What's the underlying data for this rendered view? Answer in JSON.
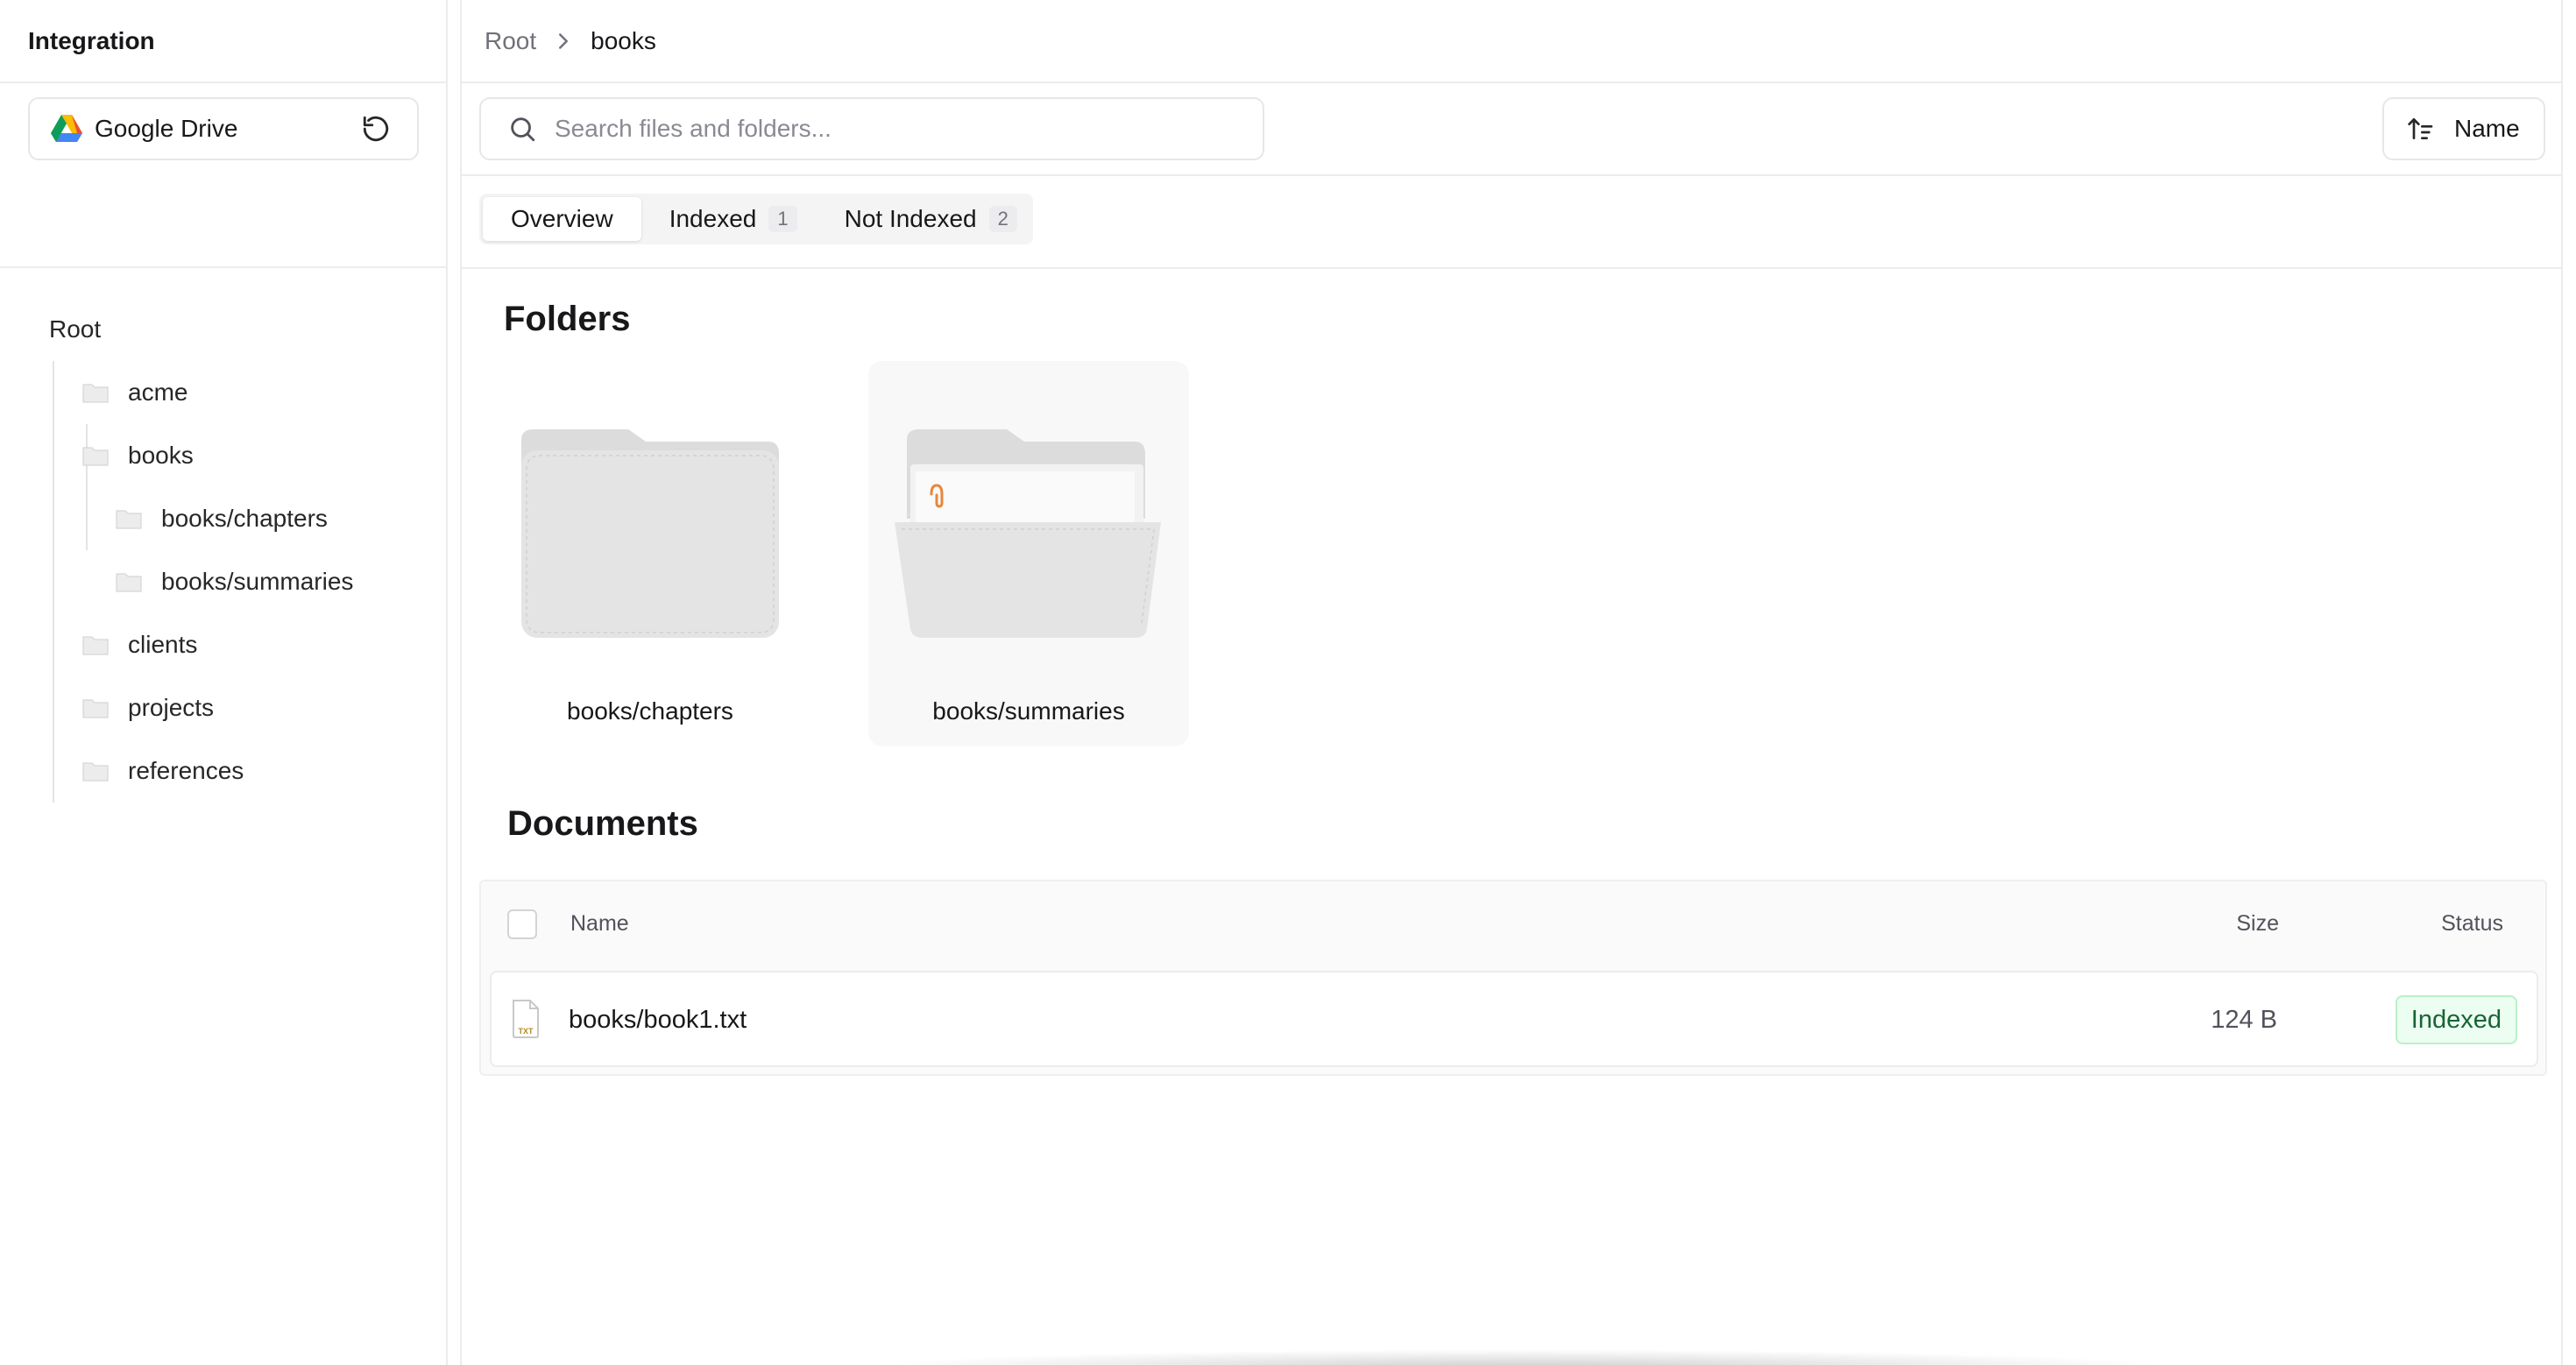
{
  "sidebar": {
    "title": "Integration",
    "source": {
      "name": "Google Drive",
      "icon": "google-drive-icon",
      "refresh_icon": "refresh-icon"
    },
    "tree": {
      "root": "Root",
      "items": [
        {
          "label": "acme",
          "depth": 1
        },
        {
          "label": "books",
          "depth": 1
        },
        {
          "label": "books/chapters",
          "depth": 2
        },
        {
          "label": "books/summaries",
          "depth": 2
        },
        {
          "label": "clients",
          "depth": 1
        },
        {
          "label": "projects",
          "depth": 1
        },
        {
          "label": "references",
          "depth": 1
        }
      ]
    }
  },
  "breadcrumb": {
    "root": "Root",
    "current": "books"
  },
  "search": {
    "placeholder": "Search files and folders...",
    "value": ""
  },
  "sort": {
    "label": "Name",
    "icon": "sort-ascending-icon"
  },
  "tabs": [
    {
      "label": "Overview",
      "count": null,
      "active": true
    },
    {
      "label": "Indexed",
      "count": "1",
      "active": false
    },
    {
      "label": "Not Indexed",
      "count": "2",
      "active": false
    }
  ],
  "folders": {
    "heading": "Folders",
    "items": [
      {
        "label": "books/chapters",
        "state": "closed"
      },
      {
        "label": "books/summaries",
        "state": "open"
      }
    ]
  },
  "documents": {
    "heading": "Documents",
    "columns": {
      "name": "Name",
      "size": "Size",
      "status": "Status"
    },
    "rows": [
      {
        "name": "books/book1.txt",
        "type": "TXT",
        "size": "124 B",
        "status": "Indexed"
      }
    ]
  },
  "colors": {
    "status_indexed_bg": "#ecfdf1",
    "status_indexed_text": "#166534",
    "border": "#ececec"
  }
}
